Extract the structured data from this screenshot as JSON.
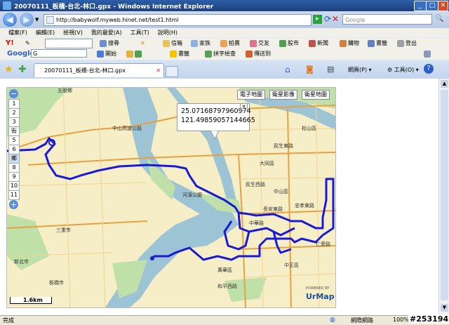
{
  "window": {
    "title": "20070111_板橋-台北-林口.gpx - Windows Internet Explorer",
    "minimize": "_",
    "maximize": "□",
    "close": "✕"
  },
  "address": {
    "url": "http://babywolf.myweb.hinet.net/test1.html",
    "search_placeholder": "Google"
  },
  "menu": [
    "檔案(F)",
    "編輯(E)",
    "檢視(V)",
    "我的最愛(A)",
    "工具(T)",
    "說明(H)"
  ],
  "yahoo_toolbar": {
    "logo": "Y!",
    "search_label": "搜尋",
    "items": [
      "信箱",
      "家族",
      "拍賣",
      "交友",
      "股市",
      "新聞",
      "購物",
      "書籤",
      "登出"
    ]
  },
  "google_toolbar": {
    "logo": "Google",
    "field_text": "G",
    "go_label": "開始",
    "bookmarks": "書籤",
    "spellcheck": "拼字檢查",
    "sendto": "傳送到"
  },
  "tab": {
    "label": "20070111_板橋-台北-林口.gpx"
  },
  "command_bar": {
    "page": "網頁(P)",
    "tools": "工具(O)"
  },
  "map": {
    "popup_line1": "25.07168797960974",
    "popup_line2": "121.49859057144665",
    "zoom_levels": [
      "1",
      "2",
      "3",
      "街市",
      "5",
      "6",
      "鄉鎮",
      "8",
      "9",
      "10",
      "11"
    ],
    "map_types": [
      "電子地圖",
      "衛星影像",
      "衛星地圖"
    ],
    "scale_label": "1.6km",
    "logo": "UrMap",
    "powered": "POWERED BY",
    "labels": [
      "五股鄉",
      "大同區",
      "中山區",
      "松山區",
      "三重市",
      "板橋市",
      "萬華區",
      "民生西路",
      "民生東路",
      "長安東路",
      "忠孝東路",
      "仁愛路",
      "中山高速公路",
      "河濱公園",
      "中華路",
      "和平西路",
      "新北市",
      "中正區"
    ]
  },
  "status": {
    "left": "完成",
    "zone": "網際網路",
    "zoom": "100%"
  },
  "watermark": "#253194",
  "colors": {
    "route": "#1a1ad6",
    "water": "#9cc4d4",
    "land": "#f6eec6",
    "park": "#bfe0a8"
  }
}
